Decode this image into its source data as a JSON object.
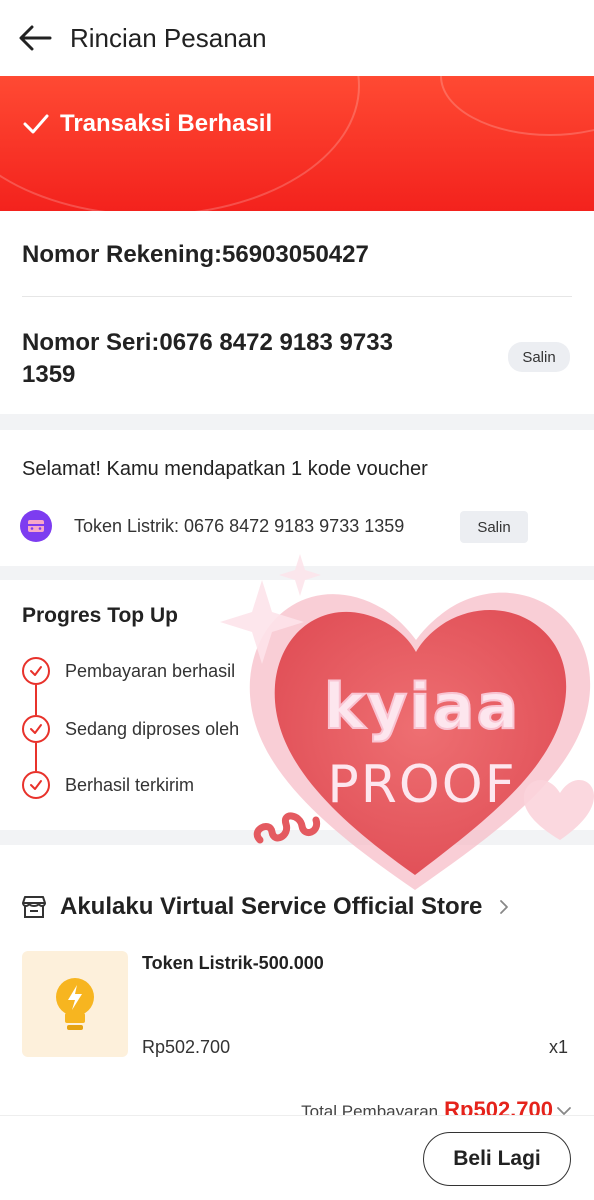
{
  "header": {
    "title": "Rincian Pesanan",
    "back_icon": "arrow-left-icon"
  },
  "banner": {
    "status": "Transaksi Berhasil",
    "color": "#f3221d",
    "icon": "check-icon"
  },
  "details": {
    "account": "Nomor Rekening:56903050427",
    "serial_line1": "Nomor Seri:0676 8472 9183 9733",
    "serial_line2": "1359",
    "copy_label": "Salin"
  },
  "voucher": {
    "congrats": "Selamat! Kamu mendapatkan 1 kode voucher",
    "token": "Token Listrik: 0676 8472 9183 9733 1359",
    "copy_label": "Salin",
    "icon": "voucher-icon"
  },
  "progress": {
    "title": "Progres Top Up",
    "steps": [
      {
        "label": "Pembayaran berhasil"
      },
      {
        "label": "Sedang diproses oleh"
      },
      {
        "label": "Berhasil terkirim"
      }
    ]
  },
  "store": {
    "name": "Akulaku Virtual Service Official Store",
    "icon": "store-icon",
    "product": {
      "name": "Token Listrik-500.000",
      "price": "Rp502.700",
      "qty": "x1",
      "icon": "bulb-icon"
    },
    "total_label": "Total Pembayaran",
    "total_value": "Rp502.700"
  },
  "footer": {
    "buy_again": "Beli Lagi"
  },
  "sticker": {
    "line1": "kyiaa",
    "line2": "PROOF"
  }
}
